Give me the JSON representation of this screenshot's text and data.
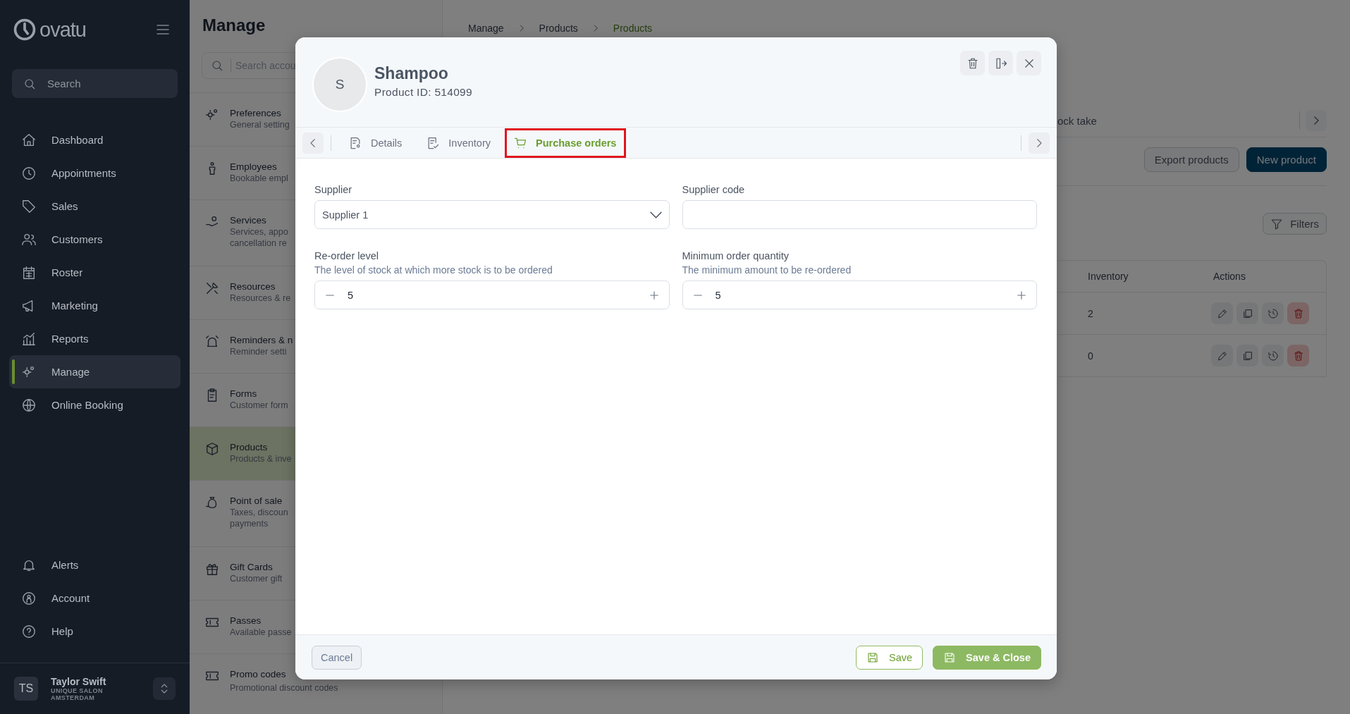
{
  "sidebar": {
    "logo": "ovatu",
    "search": {
      "placeholder": "Search"
    },
    "nav": [
      {
        "label": "Dashboard",
        "selected": false
      },
      {
        "label": "Appointments",
        "selected": false
      },
      {
        "label": "Sales",
        "selected": false
      },
      {
        "label": "Customers",
        "selected": false
      },
      {
        "label": "Roster",
        "selected": false
      },
      {
        "label": "Marketing",
        "selected": false
      },
      {
        "label": "Reports",
        "selected": false
      },
      {
        "label": "Manage",
        "selected": true
      },
      {
        "label": "Online Booking",
        "selected": false
      }
    ],
    "bottom": [
      {
        "label": "Alerts"
      },
      {
        "label": "Account"
      },
      {
        "label": "Help"
      }
    ],
    "user": {
      "initials": "TS",
      "name": "Taylor Swift",
      "org": "UNIQUE SALON",
      "city": "AMSTERDAM"
    }
  },
  "manage_panel": {
    "title": "Manage",
    "search": {
      "placeholder": "Search accou"
    },
    "items": [
      {
        "title": "Preferences",
        "lines": [
          "General setting"
        ],
        "selected": false
      },
      {
        "title": "Employees",
        "lines": [
          "Bookable empl"
        ],
        "selected": false
      },
      {
        "title": "Services",
        "lines": [
          "Services, appo",
          "cancellation re"
        ],
        "selected": false
      },
      {
        "title": "Resources",
        "lines": [
          "Resources & re"
        ],
        "selected": false
      },
      {
        "title": "Reminders & n",
        "lines": [
          "Reminder setti"
        ],
        "selected": false
      },
      {
        "title": "Forms",
        "lines": [
          "Customer form"
        ],
        "selected": false
      },
      {
        "title": "Products",
        "lines": [
          "Products & inve"
        ],
        "selected": true
      },
      {
        "title": "Point of sale",
        "lines": [
          "Taxes, discoun",
          "payments"
        ],
        "selected": false
      },
      {
        "title": "Gift Cards",
        "lines": [
          "Customer gift"
        ],
        "selected": false
      },
      {
        "title": "Passes",
        "lines": [
          "Available passe"
        ],
        "selected": false
      },
      {
        "title": "Promo codes",
        "lines": [
          "Promotional discount codes"
        ],
        "selected": false
      }
    ]
  },
  "main": {
    "breadcrumb": [
      {
        "label": "Manage",
        "selected": false
      },
      {
        "label": "Products",
        "selected": false
      },
      {
        "label": "Products",
        "selected": true
      }
    ],
    "tab_fragment": "ock take",
    "buttons": [
      {
        "label": "Export products",
        "kind": "secondary"
      },
      {
        "label": "New product",
        "kind": "primary"
      }
    ],
    "filters": "Filters",
    "table": {
      "columns": [
        "Inventory",
        "Actions"
      ],
      "rows": [
        {
          "inventory": "2"
        },
        {
          "inventory": "0"
        }
      ]
    }
  },
  "modal": {
    "avatar": "S",
    "title": "Shampoo",
    "subtitle": "Product ID: 514099",
    "tabs": [
      {
        "label": "Details",
        "selected": false
      },
      {
        "label": "Inventory",
        "selected": false
      },
      {
        "label": "Purchase orders",
        "selected": true
      }
    ],
    "fields": [
      {
        "kind": "select",
        "label": "Supplier",
        "value": "Supplier 1"
      },
      {
        "kind": "text",
        "label": "Supplier code"
      },
      {
        "kind": "stepper",
        "label": "Re-order level",
        "description": "The level of stock at which more stock is to be ordered",
        "value": "5"
      },
      {
        "kind": "stepper",
        "label": "Minimum order quantity",
        "description": "The minimum amount to be re-ordered",
        "value": "5"
      }
    ],
    "footer": [
      {
        "label": "Cancel",
        "kind": "cancel"
      },
      {
        "label": "Save",
        "kind": "outline"
      },
      {
        "label": "Save & Close",
        "kind": "primary"
      }
    ]
  }
}
